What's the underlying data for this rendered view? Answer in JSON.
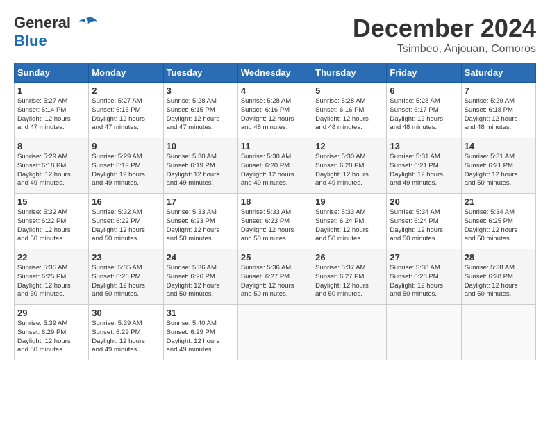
{
  "header": {
    "logo_general": "General",
    "logo_blue": "Blue",
    "month_title": "December 2024",
    "location": "Tsimbeo, Anjouan, Comoros"
  },
  "calendar": {
    "days_of_week": [
      "Sunday",
      "Monday",
      "Tuesday",
      "Wednesday",
      "Thursday",
      "Friday",
      "Saturday"
    ],
    "weeks": [
      [
        {
          "day": "1",
          "info": "Sunrise: 5:27 AM\nSunset: 6:14 PM\nDaylight: 12 hours\nand 47 minutes."
        },
        {
          "day": "2",
          "info": "Sunrise: 5:27 AM\nSunset: 6:15 PM\nDaylight: 12 hours\nand 47 minutes."
        },
        {
          "day": "3",
          "info": "Sunrise: 5:28 AM\nSunset: 6:15 PM\nDaylight: 12 hours\nand 47 minutes."
        },
        {
          "day": "4",
          "info": "Sunrise: 5:28 AM\nSunset: 6:16 PM\nDaylight: 12 hours\nand 48 minutes."
        },
        {
          "day": "5",
          "info": "Sunrise: 5:28 AM\nSunset: 6:16 PM\nDaylight: 12 hours\nand 48 minutes."
        },
        {
          "day": "6",
          "info": "Sunrise: 5:28 AM\nSunset: 6:17 PM\nDaylight: 12 hours\nand 48 minutes."
        },
        {
          "day": "7",
          "info": "Sunrise: 5:29 AM\nSunset: 6:18 PM\nDaylight: 12 hours\nand 48 minutes."
        }
      ],
      [
        {
          "day": "8",
          "info": "Sunrise: 5:29 AM\nSunset: 6:18 PM\nDaylight: 12 hours\nand 49 minutes."
        },
        {
          "day": "9",
          "info": "Sunrise: 5:29 AM\nSunset: 6:19 PM\nDaylight: 12 hours\nand 49 minutes."
        },
        {
          "day": "10",
          "info": "Sunrise: 5:30 AM\nSunset: 6:19 PM\nDaylight: 12 hours\nand 49 minutes."
        },
        {
          "day": "11",
          "info": "Sunrise: 5:30 AM\nSunset: 6:20 PM\nDaylight: 12 hours\nand 49 minutes."
        },
        {
          "day": "12",
          "info": "Sunrise: 5:30 AM\nSunset: 6:20 PM\nDaylight: 12 hours\nand 49 minutes."
        },
        {
          "day": "13",
          "info": "Sunrise: 5:31 AM\nSunset: 6:21 PM\nDaylight: 12 hours\nand 49 minutes."
        },
        {
          "day": "14",
          "info": "Sunrise: 5:31 AM\nSunset: 6:21 PM\nDaylight: 12 hours\nand 50 minutes."
        }
      ],
      [
        {
          "day": "15",
          "info": "Sunrise: 5:32 AM\nSunset: 6:22 PM\nDaylight: 12 hours\nand 50 minutes."
        },
        {
          "day": "16",
          "info": "Sunrise: 5:32 AM\nSunset: 6:22 PM\nDaylight: 12 hours\nand 50 minutes."
        },
        {
          "day": "17",
          "info": "Sunrise: 5:33 AM\nSunset: 6:23 PM\nDaylight: 12 hours\nand 50 minutes."
        },
        {
          "day": "18",
          "info": "Sunrise: 5:33 AM\nSunset: 6:23 PM\nDaylight: 12 hours\nand 50 minutes."
        },
        {
          "day": "19",
          "info": "Sunrise: 5:33 AM\nSunset: 6:24 PM\nDaylight: 12 hours\nand 50 minutes."
        },
        {
          "day": "20",
          "info": "Sunrise: 5:34 AM\nSunset: 6:24 PM\nDaylight: 12 hours\nand 50 minutes."
        },
        {
          "day": "21",
          "info": "Sunrise: 5:34 AM\nSunset: 6:25 PM\nDaylight: 12 hours\nand 50 minutes."
        }
      ],
      [
        {
          "day": "22",
          "info": "Sunrise: 5:35 AM\nSunset: 6:25 PM\nDaylight: 12 hours\nand 50 minutes."
        },
        {
          "day": "23",
          "info": "Sunrise: 5:35 AM\nSunset: 6:26 PM\nDaylight: 12 hours\nand 50 minutes."
        },
        {
          "day": "24",
          "info": "Sunrise: 5:36 AM\nSunset: 6:26 PM\nDaylight: 12 hours\nand 50 minutes."
        },
        {
          "day": "25",
          "info": "Sunrise: 5:36 AM\nSunset: 6:27 PM\nDaylight: 12 hours\nand 50 minutes."
        },
        {
          "day": "26",
          "info": "Sunrise: 5:37 AM\nSunset: 6:27 PM\nDaylight: 12 hours\nand 50 minutes."
        },
        {
          "day": "27",
          "info": "Sunrise: 5:38 AM\nSunset: 6:28 PM\nDaylight: 12 hours\nand 50 minutes."
        },
        {
          "day": "28",
          "info": "Sunrise: 5:38 AM\nSunset: 6:28 PM\nDaylight: 12 hours\nand 50 minutes."
        }
      ],
      [
        {
          "day": "29",
          "info": "Sunrise: 5:39 AM\nSunset: 6:29 PM\nDaylight: 12 hours\nand 50 minutes."
        },
        {
          "day": "30",
          "info": "Sunrise: 5:39 AM\nSunset: 6:29 PM\nDaylight: 12 hours\nand 49 minutes."
        },
        {
          "day": "31",
          "info": "Sunrise: 5:40 AM\nSunset: 6:29 PM\nDaylight: 12 hours\nand 49 minutes."
        },
        {
          "day": "",
          "info": ""
        },
        {
          "day": "",
          "info": ""
        },
        {
          "day": "",
          "info": ""
        },
        {
          "day": "",
          "info": ""
        }
      ]
    ]
  }
}
